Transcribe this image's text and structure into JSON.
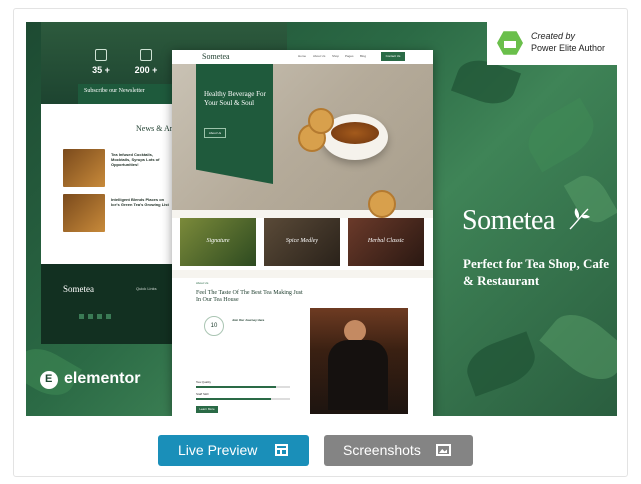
{
  "badge": {
    "line1": "Created by",
    "line2": "Power Elite Author"
  },
  "brand": {
    "name": "Sometea",
    "tagline": "Perfect for Tea Shop, Cafe & Restaurant"
  },
  "elementor": "elementor",
  "back_mockup": {
    "stats": [
      "35 +",
      "200 +"
    ],
    "newsletter": "Subscribe our Newsletter",
    "news_heading": "News & Artic",
    "posts": [
      "Tea Infused Cocktails, Mocktails, Syrups Lots of Opportunities!",
      "Intelligent Blends Places on Ice's Green Tea's Growing List"
    ],
    "footer_logo": "Sometea",
    "footer_col": "Quick Links"
  },
  "front_mockup": {
    "logo": "Sometea",
    "nav_links": [
      "Home",
      "About Us",
      "Shop",
      "Pages",
      "Blog"
    ],
    "nav_button": "Contact Us",
    "hero_title": "Healthy Beverage For Your Soul & Soul",
    "hero_button": "About Us",
    "thumbs": [
      "Signature",
      "Spice Medley",
      "Herbal Classic"
    ],
    "about_tag": "About Us",
    "about_title": "Feel The Taste Of The Best Tea Making Just In Our Tea House",
    "ring": "10",
    "join": "Join Our Journey Here",
    "bars": [
      {
        "label": "Tea Quality",
        "value": 85
      },
      {
        "label": "Staff Skill",
        "value": 80
      }
    ],
    "about_button": "Learn More"
  },
  "buttons": {
    "live": "Live Preview",
    "screenshots": "Screenshots"
  }
}
